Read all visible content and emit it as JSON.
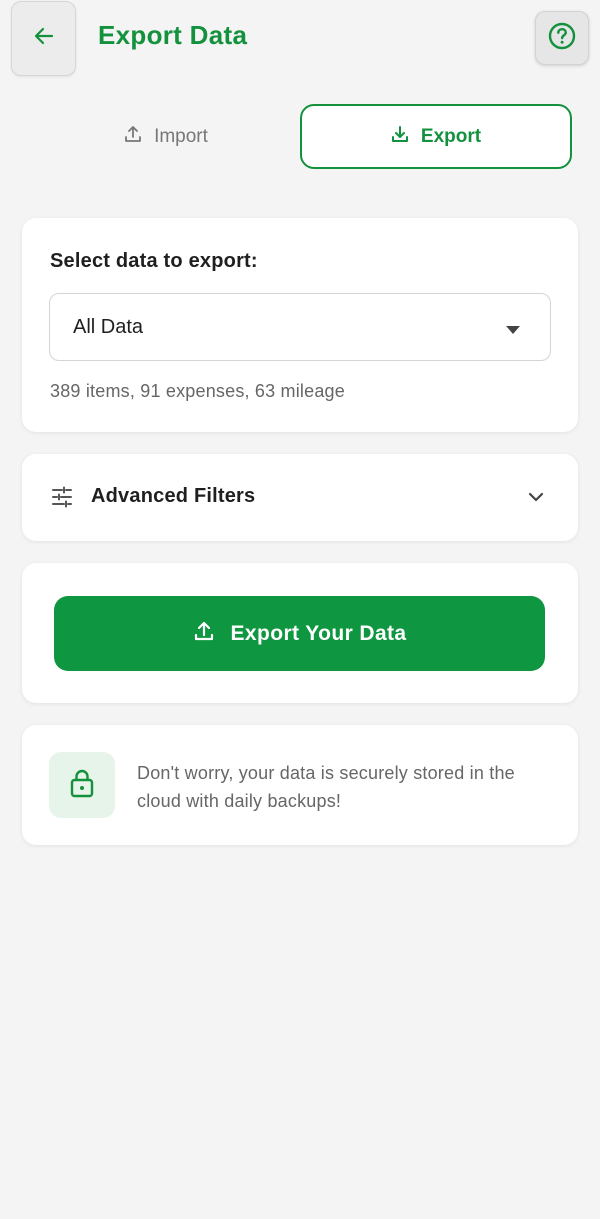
{
  "header": {
    "title": "Export Data",
    "back_icon": "arrow-left-icon",
    "help_icon": "help-circle-icon"
  },
  "tabs": [
    {
      "label": "Import",
      "icon": "upload-icon",
      "active": false
    },
    {
      "label": "Export",
      "icon": "download-icon",
      "active": true
    }
  ],
  "select_section": {
    "label": "Select data to export:",
    "selected_value": "All Data",
    "summary": "389 items, 91 expenses, 63 mileage"
  },
  "filters": {
    "label": "Advanced Filters",
    "icon": "sliders-icon",
    "expanded": false
  },
  "export_action": {
    "label": "Export Your Data",
    "icon": "upload-icon"
  },
  "info": {
    "text": "Don't worry, your data is securely stored in the cloud with daily backups!",
    "icon": "lock-icon"
  },
  "colors": {
    "brand_green": "#14913d",
    "button_green": "#0e9640",
    "info_tint": "#e7f4ea",
    "background": "#f4f4f4"
  }
}
